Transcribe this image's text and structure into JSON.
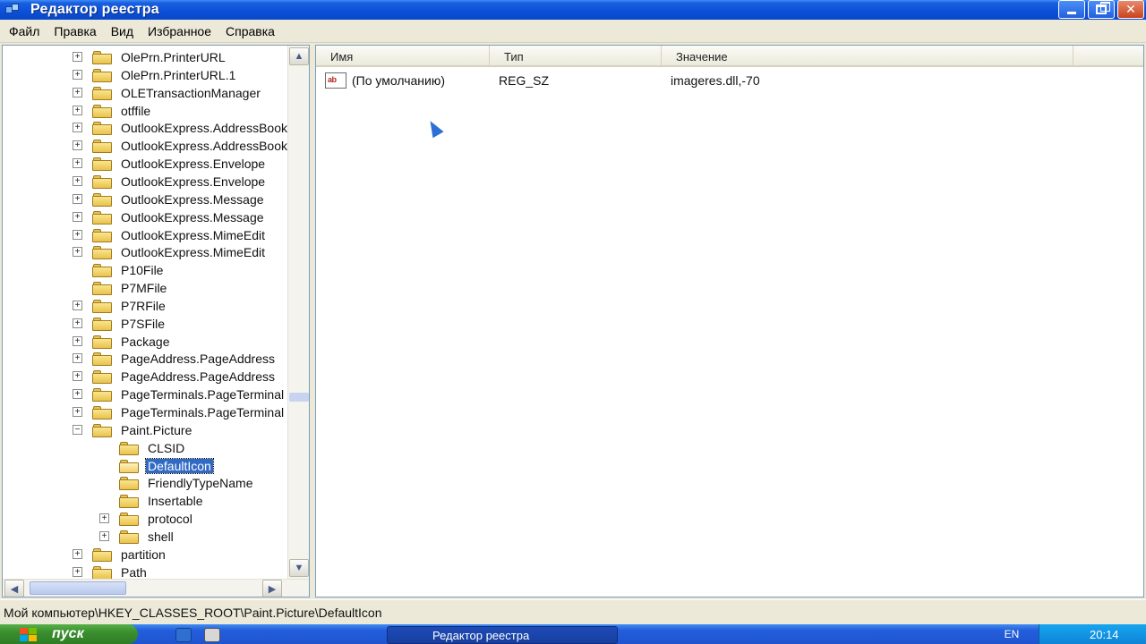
{
  "window": {
    "title": "Редактор реестра",
    "controls": {
      "minimize": "",
      "maximize": "",
      "close": "✕"
    }
  },
  "menu": {
    "items": [
      {
        "label": "Файл"
      },
      {
        "label": "Правка"
      },
      {
        "label": "Вид"
      },
      {
        "label": "Избранное"
      },
      {
        "label": "Справка"
      }
    ]
  },
  "tree": {
    "items": [
      {
        "label": "OlePrn.PrinterURL",
        "level": 0,
        "expander": "+"
      },
      {
        "label": "OlePrn.PrinterURL.1",
        "level": 0,
        "expander": "+"
      },
      {
        "label": "OLETransactionManager",
        "level": 0,
        "expander": "+"
      },
      {
        "label": "otffile",
        "level": 0,
        "expander": "+"
      },
      {
        "label": "OutlookExpress.AddressBook",
        "level": 0,
        "expander": "+"
      },
      {
        "label": "OutlookExpress.AddressBook",
        "level": 0,
        "expander": "+"
      },
      {
        "label": "OutlookExpress.Envelope",
        "level": 0,
        "expander": "+"
      },
      {
        "label": "OutlookExpress.Envelope",
        "level": 0,
        "expander": "+"
      },
      {
        "label": "OutlookExpress.Message",
        "level": 0,
        "expander": "+"
      },
      {
        "label": "OutlookExpress.Message",
        "level": 0,
        "expander": "+"
      },
      {
        "label": "OutlookExpress.MimeEdit",
        "level": 0,
        "expander": "+"
      },
      {
        "label": "OutlookExpress.MimeEdit",
        "level": 0,
        "expander": "+"
      },
      {
        "label": "P10File",
        "level": 0,
        "expander": ""
      },
      {
        "label": "P7MFile",
        "level": 0,
        "expander": ""
      },
      {
        "label": "P7RFile",
        "level": 0,
        "expander": "+"
      },
      {
        "label": "P7SFile",
        "level": 0,
        "expander": "+"
      },
      {
        "label": "Package",
        "level": 0,
        "expander": "+"
      },
      {
        "label": "PageAddress.PageAddress",
        "level": 0,
        "expander": "+"
      },
      {
        "label": "PageAddress.PageAddress",
        "level": 0,
        "expander": "+"
      },
      {
        "label": "PageTerminals.PageTerminal",
        "level": 0,
        "expander": "+"
      },
      {
        "label": "PageTerminals.PageTerminal",
        "level": 0,
        "expander": "+"
      },
      {
        "label": "Paint.Picture",
        "level": 0,
        "expander": "−"
      },
      {
        "label": "CLSID",
        "level": 1,
        "expander": ""
      },
      {
        "label": "DefaultIcon",
        "level": 1,
        "expander": "",
        "selected": true
      },
      {
        "label": "FriendlyTypeName",
        "level": 1,
        "expander": ""
      },
      {
        "label": "Insertable",
        "level": 1,
        "expander": ""
      },
      {
        "label": "protocol",
        "level": 1,
        "expander": "+"
      },
      {
        "label": "shell",
        "level": 1,
        "expander": "+"
      },
      {
        "label": "partition",
        "level": 0,
        "expander": "+"
      },
      {
        "label": "Path",
        "level": 0,
        "expander": "+"
      }
    ],
    "scroll_up": "▲",
    "scroll_down": "▼",
    "scroll_left": "◀",
    "scroll_right": "▶"
  },
  "list": {
    "columns": [
      {
        "label": "Имя"
      },
      {
        "label": "Тип"
      },
      {
        "label": "Значение"
      }
    ],
    "rows": [
      {
        "icon": "ab",
        "name": "(По умолчанию)",
        "type": "REG_SZ",
        "value": "imageres.dll,-70"
      }
    ]
  },
  "status": {
    "path": "Мой компьютер\\HKEY_CLASSES_ROOT\\Paint.Picture\\DefaultIcon"
  },
  "taskbar": {
    "start_label": "пуск",
    "task_label": "Редактор реестра",
    "lang": "EN",
    "clock": "20:14"
  },
  "colors": {
    "titlebar": "#0b4fd8",
    "selection": "#316ac5",
    "chrome": "#ece9d8",
    "start": "#3a8f2e"
  }
}
